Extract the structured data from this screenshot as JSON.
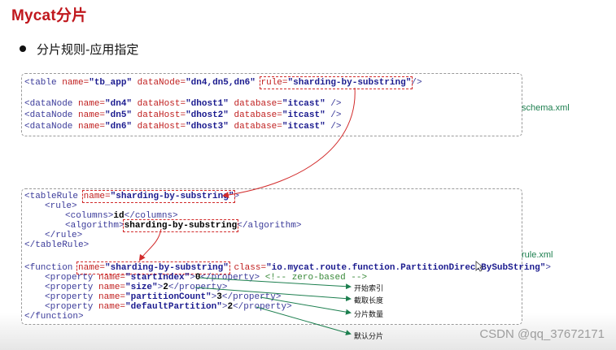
{
  "slide": {
    "title": "Mycat分片",
    "bullet": "分片规则-应用指定",
    "schema_label": "schema.xml",
    "rule_label": "rule.xml",
    "watermark": "CSDN @qq_37672171"
  },
  "schema_code": {
    "line1": {
      "a": "<table ",
      "b": "name=",
      "c": "\"tb_app\"",
      "d": " dataNode=",
      "e": "\"dn4,dn5,dn6\"",
      "hl_attr": "rule=",
      "hl_val": "\"sharding-by-substring\"",
      "end": "/>"
    },
    "datanodes": [
      {
        "name": "\"dn4\"",
        "host": "\"dhost1\"",
        "db": "\"itcast\""
      },
      {
        "name": "\"dn5\"",
        "host": "\"dhost2\"",
        "db": "\"itcast\""
      },
      {
        "name": "\"dn6\"",
        "host": "\"dhost3\"",
        "db": "\"itcast\""
      }
    ],
    "dn_open": "<dataNode ",
    "dn_name": "name=",
    "dn_host": " dataHost=",
    "dn_db": " database=",
    "dn_end": " />"
  },
  "rule_code": {
    "tr_open": "<tableRule ",
    "tr_hl_attr": "name=",
    "tr_hl_val": "\"sharding-by-substring\"",
    "tr_gt": ">",
    "rule_open": "<rule>",
    "columns_open": "<columns>",
    "columns_val": "id",
    "columns_close": "</columns>",
    "alg_open": "<algorithm>",
    "alg_val": "sharding-by-substring",
    "alg_close": "</algorithm>",
    "rule_close": "</rule>",
    "tr_close": "</tableRule>",
    "fn_open": "<function ",
    "fn_hl_attr": "name=",
    "fn_hl_val": "\"sharding-by-substring\"",
    "fn_class_attr": " class=",
    "fn_class_val": "\"io.mycat.route.function.PartitionDirectBySubString\"",
    "fn_gt": ">",
    "prop_open": "<property ",
    "prop_name": "name=",
    "prop_close": "</property>",
    "properties": [
      {
        "name": "\"startIndex\"",
        "value": "0",
        "comment": " <!-- zero-based -->"
      },
      {
        "name": "\"size\"",
        "value": "2",
        "comment": ""
      },
      {
        "name": "\"partitionCount\"",
        "value": "3",
        "comment": ""
      },
      {
        "name": "\"defaultPartition\"",
        "value": "2",
        "comment": ""
      }
    ],
    "fn_close": "</function>"
  },
  "annotations": [
    "开始索引",
    "截取长度",
    "分片数量",
    "默认分片"
  ],
  "colors": {
    "title": "#c0171d",
    "highlight": "#d22b2b",
    "annotation_arrow": "#1d7f4f"
  }
}
